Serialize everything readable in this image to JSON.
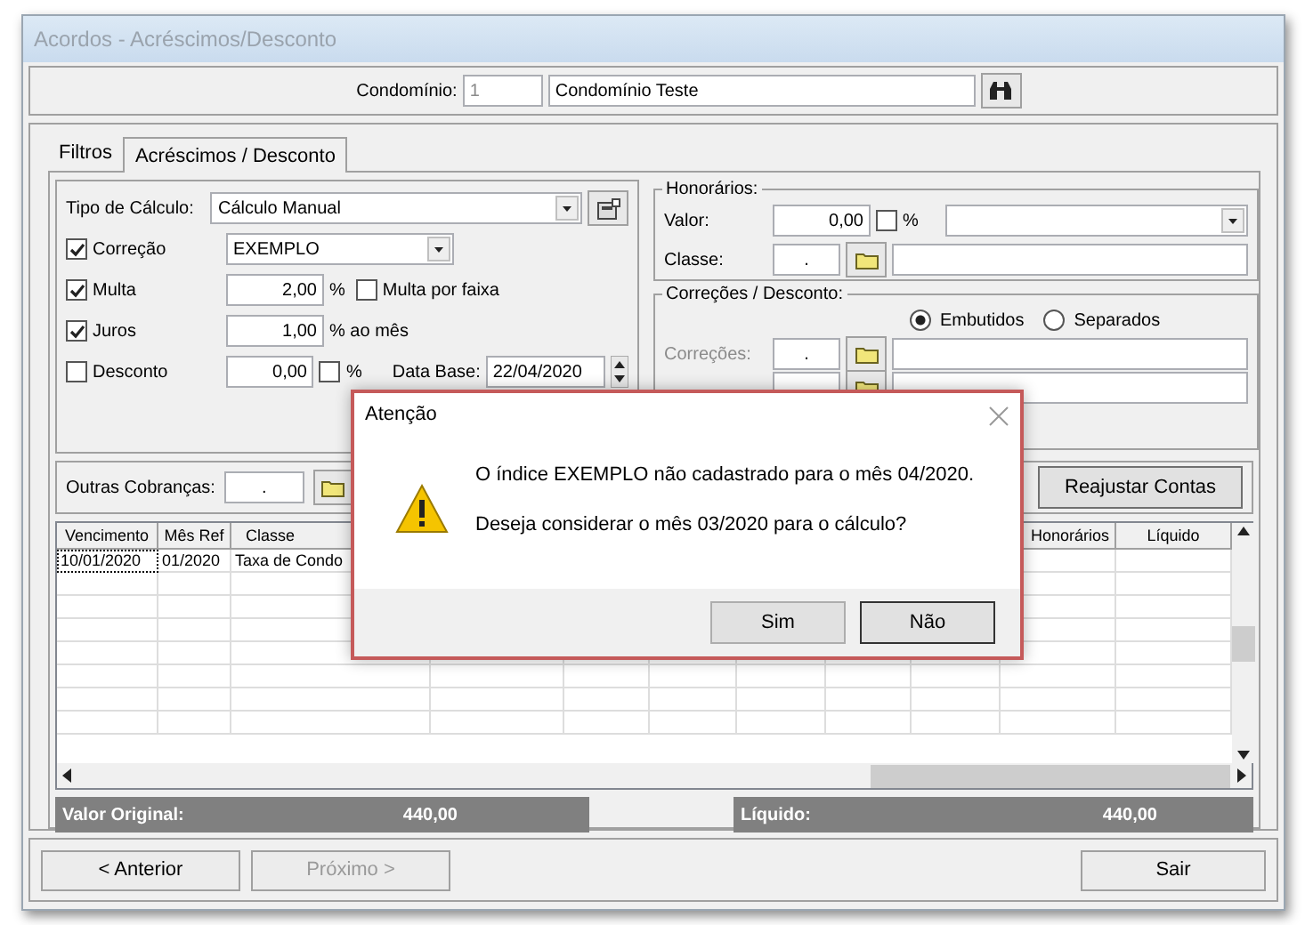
{
  "window": {
    "title": "Acordos - Acréscimos/Desconto"
  },
  "condominio": {
    "label": "Condomínio:",
    "code": "1",
    "name": "Condomínio Teste"
  },
  "tabs": [
    {
      "label": "Filtros",
      "selected": false
    },
    {
      "label": "Acréscimos / Desconto",
      "selected": true
    }
  ],
  "calculo": {
    "label": "Tipo de Cálculo:",
    "value": "Cálculo Manual"
  },
  "options": [
    {
      "kind": "combo",
      "label": "Correção",
      "checked": true,
      "value": "EXEMPLO"
    },
    {
      "kind": "number",
      "label": "Multa",
      "checked": true,
      "value": "2,00",
      "suffix": "%",
      "extra": {
        "label": "Multa por faixa",
        "checked": false
      }
    },
    {
      "kind": "number",
      "label": "Juros",
      "checked": true,
      "value": "1,00",
      "suffix": "% ao mês"
    },
    {
      "kind": "discount",
      "label": "Desconto",
      "checked": false,
      "value": "0,00",
      "percent": {
        "label": "%",
        "checked": false
      },
      "date_label": "Data Base:",
      "date": "22/04/2020"
    }
  ],
  "honorarios": {
    "title": "Honorários:",
    "valor_label": "Valor:",
    "valor": "0,00",
    "percent": {
      "label": "%",
      "checked": false
    },
    "classe_label": "Classe:",
    "classe_code": "."
  },
  "correcoes": {
    "title": "Correções / Desconto:",
    "modes": [
      {
        "label": "Embutidos",
        "selected": true
      },
      {
        "label": "Separados",
        "selected": false
      }
    ],
    "field_label": "Correções:",
    "code": ".",
    "disabled": true
  },
  "outras": {
    "label": "Outras Cobranças:",
    "code": ".",
    "button": "Reajustar Contas"
  },
  "table": {
    "columns": [
      {
        "label": "Vencimento"
      },
      {
        "label": "Mês Ref"
      },
      {
        "label": "Classe"
      },
      {
        "label": "Honorários"
      },
      {
        "label": "Líquido"
      }
    ],
    "rows": [
      {
        "cells": [
          "10/01/2020",
          "01/2020",
          "Taxa de Condo"
        ],
        "selected": true
      }
    ]
  },
  "totals": [
    {
      "label": "Valor Original:",
      "value": "440,00"
    },
    {
      "label": "Líquido:",
      "value": "440,00"
    }
  ],
  "buttons": [
    {
      "label": "< Anterior",
      "disabled": false
    },
    {
      "label": "Próximo >",
      "disabled": true
    },
    {
      "label": "Sair",
      "disabled": false
    }
  ],
  "dialog": {
    "title": "Atenção",
    "lines": [
      "O índice EXEMPLO não cadastrado para o mês 04/2020.",
      "Deseja considerar o mês 03/2020 para o cálculo?"
    ],
    "buttons": [
      {
        "label": "Sim",
        "selected": false
      },
      {
        "label": "Não",
        "selected": true
      }
    ]
  }
}
